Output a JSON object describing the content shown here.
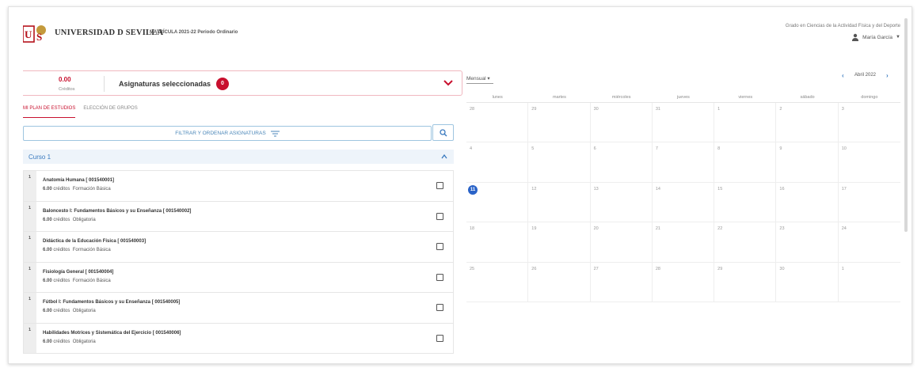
{
  "header": {
    "university": "UNIVERSIDAD D SEVILLA",
    "matricula": "MATRÍCULA 2021-22 Periodo Ordinario",
    "degree": "Grado en Ciencias de la Actividad Física y del Deporte",
    "user_name": "María García"
  },
  "summary": {
    "credits_value": "0.00",
    "credits_label": "Créditos",
    "selected_title": "Asignaturas seleccionadas",
    "selected_count": "0"
  },
  "tabs": [
    {
      "label": "MI PLAN DE ESTUDIOS",
      "active": true
    },
    {
      "label": "ELECCIÓN DE GRUPOS",
      "active": false
    }
  ],
  "filter": {
    "label": "FILTRAR Y ORDENAR ASIGNATURAS"
  },
  "curso": {
    "title": "Curso 1"
  },
  "subjects": [
    {
      "num": "1",
      "name": "Anatomía Humana [ 001540001]",
      "credits": "6.00",
      "credits_word": "créditos",
      "type": "Formación Básica"
    },
    {
      "num": "1",
      "name": "Baloncesto I: Fundamentos Básicos y su Enseñanza [ 001540002]",
      "credits": "6.00",
      "credits_word": "créditos",
      "type": "Obligatoria"
    },
    {
      "num": "1",
      "name": "Didáctica de la Educación Física [ 001540003]",
      "credits": "6.00",
      "credits_word": "créditos",
      "type": "Formación Básica"
    },
    {
      "num": "1",
      "name": "Fisiología General [ 001540004]",
      "credits": "6.00",
      "credits_word": "créditos",
      "type": "Formación Básica"
    },
    {
      "num": "1",
      "name": "Fútbol I: Fundamentos Básicos y su Enseñanza [ 001540005]",
      "credits": "6.00",
      "credits_word": "créditos",
      "type": "Obligatoria"
    },
    {
      "num": "1",
      "name": "Habilidades Motrices y Sistemática del Ejercicio [ 001540006]",
      "credits": "6.00",
      "credits_word": "créditos",
      "type": "Obligatoria"
    }
  ],
  "calendar": {
    "view": "Mensual",
    "month_label": "Abril 2022",
    "weekdays": [
      "lunes",
      "martes",
      "miércoles",
      "jueves",
      "viernes",
      "sábado",
      "domingo"
    ],
    "days": [
      "28",
      "29",
      "30",
      "31",
      "1",
      "2",
      "3",
      "4",
      "5",
      "6",
      "7",
      "8",
      "9",
      "10",
      "11",
      "12",
      "13",
      "14",
      "15",
      "16",
      "17",
      "18",
      "19",
      "20",
      "21",
      "22",
      "23",
      "24",
      "25",
      "26",
      "27",
      "28",
      "29",
      "30",
      "1"
    ],
    "today": "11"
  },
  "colors": {
    "accent": "#c8102e",
    "link": "#3a7abf",
    "today": "#2a63c8"
  },
  "icons": [
    "user-icon",
    "chevron-down-icon",
    "filter-icon",
    "search-icon",
    "chevron-up-icon",
    "chevron-left-icon",
    "chevron-right-icon"
  ]
}
